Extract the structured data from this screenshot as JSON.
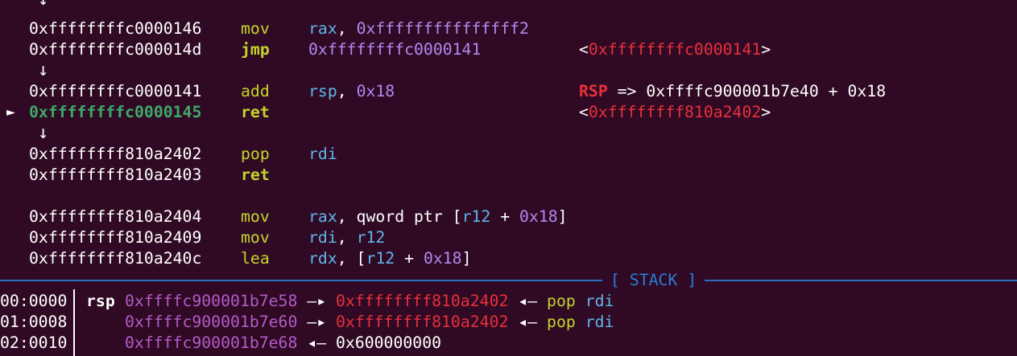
{
  "disasm": [
    {
      "kind": "arrow",
      "glyph": "↓"
    },
    {
      "kind": "insn",
      "addr": "0xffffffffc0000146",
      "mnem": "mov",
      "ops": [
        {
          "t": "rax",
          "c": "reg"
        },
        {
          "t": ", ",
          "c": "plain"
        },
        {
          "t": "0xfffffffffffffff2",
          "c": "num"
        }
      ],
      "note": []
    },
    {
      "kind": "insn",
      "addr": "0xffffffffc000014d",
      "mnem": "jmp",
      "mnem_bold": true,
      "ops": [
        {
          "t": "0xffffffffc0000141",
          "c": "num"
        }
      ],
      "note": [
        {
          "t": "<",
          "c": "plain"
        },
        {
          "t": "0xffffffffc0000141",
          "c": "red"
        },
        {
          "t": ">",
          "c": "plain"
        }
      ]
    },
    {
      "kind": "arrow",
      "glyph": "↓"
    },
    {
      "kind": "insn",
      "addr": "0xffffffffc0000141",
      "mnem": "add",
      "ops": [
        {
          "t": "rsp",
          "c": "reg"
        },
        {
          "t": ", ",
          "c": "plain"
        },
        {
          "t": "0x18",
          "c": "num"
        }
      ],
      "note": [
        {
          "t": "RSP",
          "c": "red-bold"
        },
        {
          "t": " => 0xffffc900001b7e40 + 0x18",
          "c": "plain"
        }
      ]
    },
    {
      "kind": "insn",
      "current": true,
      "pointer": "►",
      "addr": "0xffffffffc0000145",
      "mnem": "ret",
      "mnem_bold": true,
      "ops": [],
      "note": [
        {
          "t": "<",
          "c": "plain"
        },
        {
          "t": "0xffffffff810a2402",
          "c": "red"
        },
        {
          "t": ">",
          "c": "plain"
        }
      ]
    },
    {
      "kind": "arrow",
      "glyph": "↓"
    },
    {
      "kind": "insn",
      "addr": "0xffffffff810a2402",
      "mnem": "pop",
      "ops": [
        {
          "t": "rdi",
          "c": "reg"
        }
      ],
      "note": []
    },
    {
      "kind": "insn",
      "addr": "0xffffffff810a2403",
      "mnem": "ret",
      "mnem_bold": true,
      "ops": [],
      "note": []
    },
    {
      "kind": "blank"
    },
    {
      "kind": "insn",
      "addr": "0xffffffff810a2404",
      "mnem": "mov",
      "ops": [
        {
          "t": "rax",
          "c": "reg"
        },
        {
          "t": ", qword ptr [",
          "c": "plain"
        },
        {
          "t": "r12",
          "c": "reg"
        },
        {
          "t": " + ",
          "c": "plain"
        },
        {
          "t": "0x18",
          "c": "num"
        },
        {
          "t": "]",
          "c": "plain"
        }
      ],
      "note": []
    },
    {
      "kind": "insn",
      "addr": "0xffffffff810a2409",
      "mnem": "mov",
      "ops": [
        {
          "t": "rdi",
          "c": "reg"
        },
        {
          "t": ", ",
          "c": "plain"
        },
        {
          "t": "r12",
          "c": "reg"
        }
      ],
      "note": []
    },
    {
      "kind": "insn",
      "addr": "0xffffffff810a240c",
      "mnem": "lea",
      "ops": [
        {
          "t": "rdx",
          "c": "reg"
        },
        {
          "t": ", [",
          "c": "plain"
        },
        {
          "t": "r12",
          "c": "reg"
        },
        {
          "t": " + ",
          "c": "plain"
        },
        {
          "t": "0x18",
          "c": "num"
        },
        {
          "t": "]",
          "c": "plain"
        }
      ],
      "note": []
    }
  ],
  "stack_header": "[ STACK ]",
  "stack": [
    {
      "idx": "00:0000",
      "reg": "rsp",
      "addr": "0xffffc900001b7e58",
      "rest": [
        {
          "t": " —▸ ",
          "c": "plain"
        },
        {
          "t": "0xffffffff810a2402",
          "c": "stack-red"
        },
        {
          "t": " ◂— ",
          "c": "plain"
        },
        {
          "t": "pop",
          "c": "mnem"
        },
        {
          "t": " ",
          "c": "plain"
        },
        {
          "t": "rdi",
          "c": "reg"
        }
      ]
    },
    {
      "idx": "01:0008",
      "reg": "",
      "addr": "0xffffc900001b7e60",
      "rest": [
        {
          "t": " —▸ ",
          "c": "plain"
        },
        {
          "t": "0xffffffff810a2402",
          "c": "stack-red"
        },
        {
          "t": " ◂— ",
          "c": "plain"
        },
        {
          "t": "pop",
          "c": "mnem"
        },
        {
          "t": " ",
          "c": "plain"
        },
        {
          "t": "rdi",
          "c": "reg"
        }
      ]
    },
    {
      "idx": "02:0010",
      "reg": "",
      "addr": "0xffffc900001b7e68",
      "rest": [
        {
          "t": " ◂— ",
          "c": "plain"
        },
        {
          "t": "0x600000000",
          "c": "plain"
        }
      ]
    }
  ]
}
